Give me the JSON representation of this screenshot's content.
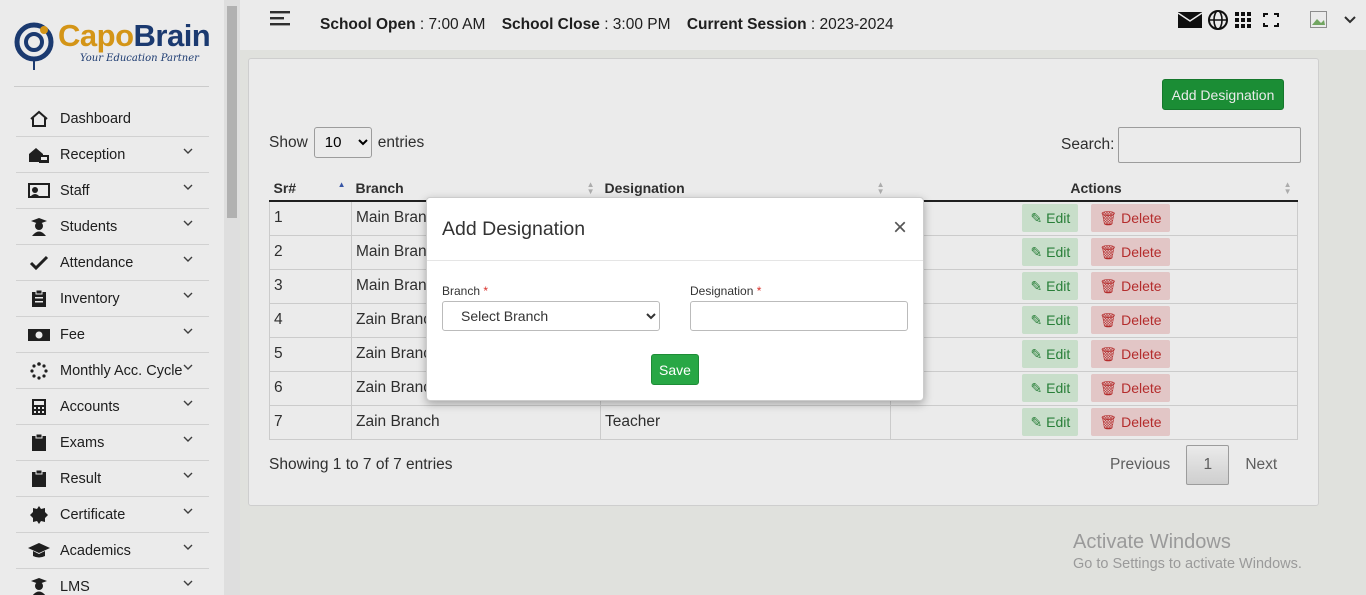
{
  "brand": {
    "name_part1": "Capo",
    "name_part2": "Brain",
    "tagline": "Your Education Partner"
  },
  "sidebar": {
    "items": [
      {
        "label": "Dashboard",
        "icon": "home-icon"
      },
      {
        "label": "Reception",
        "icon": "reception-icon"
      },
      {
        "label": "Staff",
        "icon": "staff-icon"
      },
      {
        "label": "Students",
        "icon": "students-icon"
      },
      {
        "label": "Attendance",
        "icon": "check-icon"
      },
      {
        "label": "Inventory",
        "icon": "clipboard-icon"
      },
      {
        "label": "Fee",
        "icon": "money-icon"
      },
      {
        "label": "Monthly Acc. Cycle",
        "icon": "spinner-icon"
      },
      {
        "label": "Accounts",
        "icon": "calculator-icon"
      },
      {
        "label": "Exams",
        "icon": "clipboard-icon"
      },
      {
        "label": "Result",
        "icon": "clipboard-icon"
      },
      {
        "label": "Certificate",
        "icon": "certificate-icon"
      },
      {
        "label": "Academics",
        "icon": "graduation-cap-icon"
      },
      {
        "label": "LMS",
        "icon": "graduate-icon"
      }
    ]
  },
  "header": {
    "open_label": "School Open",
    "open_value": " : 7:00 AM",
    "close_label": "School Close",
    "close_value": " : 3:00 PM",
    "session_label": "Current Session",
    "session_value": " : 2023-2024"
  },
  "main": {
    "add_button": "Add Designation",
    "show_label": "Show",
    "entries_value": "10",
    "entries_label": "entries",
    "search_label": "Search:",
    "columns": [
      "Sr#",
      "Branch",
      "Designation",
      "Actions"
    ],
    "rows": [
      {
        "sr": "1",
        "branch": "Main Branch",
        "designation": ""
      },
      {
        "sr": "2",
        "branch": "Main Branch",
        "designation": ""
      },
      {
        "sr": "3",
        "branch": "Main Branch",
        "designation": ""
      },
      {
        "sr": "4",
        "branch": "Zain Branch",
        "designation": ""
      },
      {
        "sr": "5",
        "branch": "Zain Branch",
        "designation": ""
      },
      {
        "sr": "6",
        "branch": "Zain Branch",
        "designation": ""
      },
      {
        "sr": "7",
        "branch": "Zain Branch",
        "designation": "Teacher"
      }
    ],
    "edit_label": "Edit",
    "delete_label": "Delete",
    "info": "Showing 1 to 7 of 7 entries",
    "prev": "Previous",
    "page": "1",
    "next": "Next"
  },
  "modal": {
    "title": "Add Designation",
    "close": "×",
    "branch_label": "Branch",
    "designation_label": "Designation",
    "required": "*",
    "branch_placeholder": "Select Branch",
    "save": "Save"
  },
  "watermark": {
    "line1": "Activate Windows",
    "line2": "Go to Settings to activate Windows."
  },
  "colors": {
    "accent_green": "#1e9a3a",
    "save_green": "#28a745",
    "delete_red": "#c43030",
    "brand_orange": "#e6a21a",
    "brand_blue": "#1e3f7a"
  }
}
